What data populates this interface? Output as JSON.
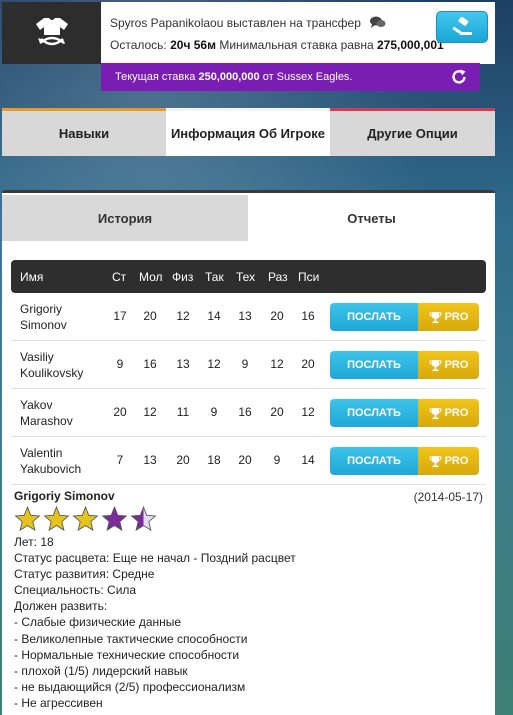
{
  "banner": {
    "icon": "shirt-transfer-icon",
    "player": "Spyros Papanikolaou",
    "message": "выставлен на трансфер",
    "remaining_label": "Осталось:",
    "remaining_value": "20ч 56м",
    "min_bid_label": "Минимальная ставка равна",
    "min_bid_value": "275,000,001",
    "bid_icon": "gavel-icon",
    "chat_icon": "chat-bubbles-icon"
  },
  "bid_bar": {
    "label": "Текущая ставка",
    "amount": "250,000,000",
    "from_label": "от",
    "bidder": "Sussex Eagles.",
    "refresh_icon": "refresh-icon"
  },
  "main_tabs": [
    "Навыки",
    "Информация Об Игроке",
    "Другие Опции"
  ],
  "sub_tabs": [
    "История",
    "Отчеты"
  ],
  "table": {
    "columns": [
      "Имя",
      "Ст",
      "Мол",
      "Физ",
      "Так",
      "Тех",
      "Раз",
      "Пси"
    ],
    "rows": [
      {
        "first": "Grigoriy",
        "last": "Simonov",
        "vals": [
          "17",
          "20",
          "12",
          "14",
          "13",
          "20",
          "16"
        ]
      },
      {
        "first": "Vasiliy",
        "last": "Koulikovsky",
        "vals": [
          "9",
          "16",
          "13",
          "12",
          "9",
          "12",
          "20"
        ]
      },
      {
        "first": "Yakov",
        "last": "Marashov",
        "vals": [
          "20",
          "12",
          "11",
          "9",
          "16",
          "20",
          "12"
        ]
      },
      {
        "first": "Valentin",
        "last": "Yakubovich",
        "vals": [
          "7",
          "13",
          "20",
          "18",
          "20",
          "9",
          "14"
        ]
      }
    ],
    "send_label": "ПОСЛАТЬ",
    "pro_label": "PRO"
  },
  "report": {
    "name": "Grigoriy Simonov",
    "date": "(2014-05-17)",
    "rating": {
      "gold": 3,
      "purple": 1.5,
      "max": 5
    },
    "colors": {
      "gold": "#e8c21c",
      "purple": "#7a2a9a"
    },
    "lines": [
      "Лет: 18",
      "Статус расцвета: Еще не начал - Поздний расцвет",
      "Статус развития: Средне",
      "Специальность: Сила",
      "Должен развить:",
      "- Слабые физические данные",
      "- Великолепные тактические способности",
      "- Нормальные технические способности",
      "- плохой (1/5) лидерский навык",
      "- не выдающийся (2/5) профессионализм",
      "- Не агрессивен"
    ]
  }
}
